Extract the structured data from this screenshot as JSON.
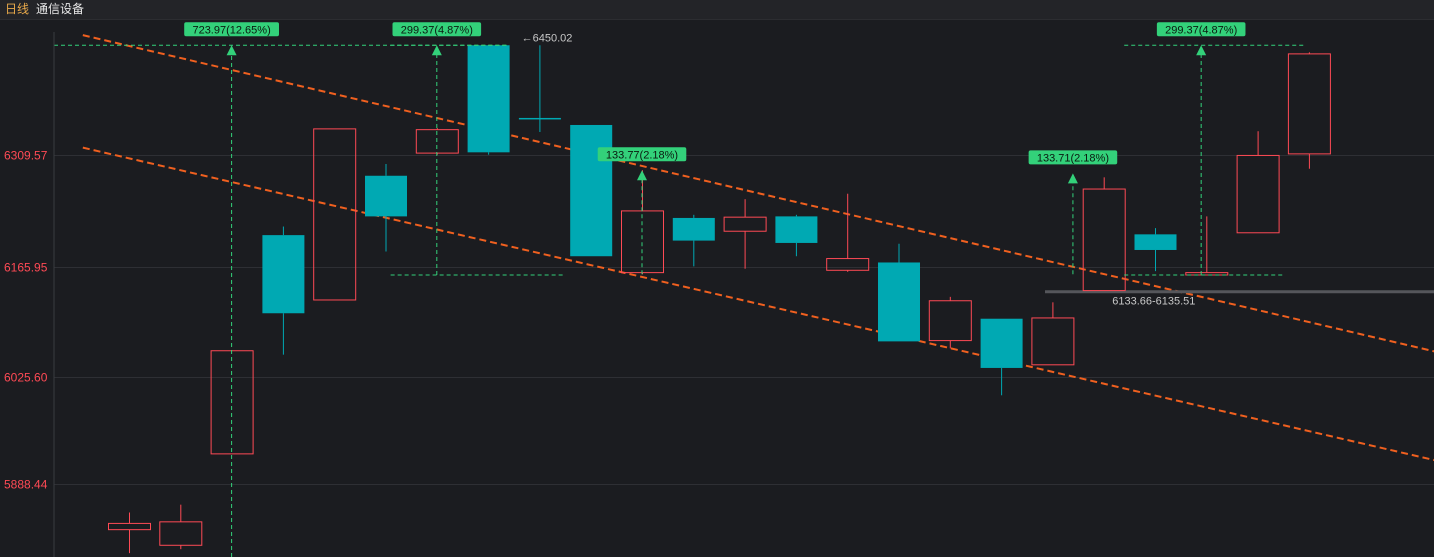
{
  "header": {
    "timeframe": "日线",
    "symbol": "通信设备"
  },
  "colors": {
    "up": "#ff4a55",
    "down": "#00a9b3",
    "trend": "#f0601f",
    "measure": "#33d17a",
    "grid": "#2e2f34",
    "axis": "#ff4a55"
  },
  "chart_data": {
    "type": "candlestick",
    "y_ticks": [
      6309.57,
      6165.95,
      6025.6,
      5888.44
    ],
    "ylim": [
      5800,
      6490
    ],
    "candles": [
      {
        "o": 5830,
        "c": 5838,
        "h": 5852,
        "l": 5800,
        "dir": "up"
      },
      {
        "o": 5810,
        "c": 5840,
        "h": 5862,
        "l": 5805,
        "dir": "up"
      },
      {
        "o": 5927,
        "c": 6059,
        "h": 6059,
        "l": 5927,
        "dir": "up"
      },
      {
        "o": 6207,
        "c": 6107,
        "h": 6218,
        "l": 6054,
        "dir": "down"
      },
      {
        "o": 6124,
        "c": 6343,
        "h": 6343,
        "l": 6124,
        "dir": "up"
      },
      {
        "o": 6231,
        "c": 6283,
        "h": 6298,
        "l": 6186,
        "dir": "down"
      },
      {
        "o": 6312,
        "c": 6342,
        "h": 6344,
        "l": 6310,
        "dir": "up"
      },
      {
        "o": 6450.02,
        "c": 6313,
        "h": 6450.02,
        "l": 6310,
        "dir": "down"
      },
      {
        "o": 6356,
        "c": 6357,
        "h": 6450,
        "l": 6339,
        "dir": "down"
      },
      {
        "o": 6348,
        "c": 6180,
        "h": 6348,
        "l": 6180,
        "dir": "down"
      },
      {
        "o": 6159,
        "c": 6238,
        "h": 6290,
        "l": 6157,
        "dir": "up"
      },
      {
        "o": 6229,
        "c": 6200,
        "h": 6233,
        "l": 6167,
        "dir": "down"
      },
      {
        "o": 6212,
        "c": 6230,
        "h": 6253,
        "l": 6164,
        "dir": "up"
      },
      {
        "o": 6231,
        "c": 6197,
        "h": 6233,
        "l": 6180,
        "dir": "down"
      },
      {
        "o": 6162,
        "c": 6177,
        "h": 6260,
        "l": 6160,
        "dir": "up"
      },
      {
        "o": 6172,
        "c": 6071,
        "h": 6196,
        "l": 6071,
        "dir": "down"
      },
      {
        "o": 6072,
        "c": 6123,
        "h": 6128,
        "l": 6062,
        "dir": "up"
      },
      {
        "o": 6100,
        "c": 6037,
        "h": 6100,
        "l": 6002,
        "dir": "down"
      },
      {
        "o": 6041,
        "c": 6101,
        "h": 6121,
        "l": 6041,
        "dir": "up"
      },
      {
        "o": 6136,
        "c": 6266,
        "h": 6281,
        "l": 6136,
        "dir": "up"
      },
      {
        "o": 6208,
        "c": 6188,
        "h": 6216,
        "l": 6161,
        "dir": "down"
      },
      {
        "o": 6156,
        "c": 6159,
        "h": 6231,
        "l": 6156,
        "dir": "up"
      },
      {
        "o": 6210,
        "c": 6309,
        "h": 6340,
        "l": 6210,
        "dir": "up"
      },
      {
        "o": 6311,
        "c": 6439,
        "h": 6441,
        "l": 6292,
        "dir": "up"
      }
    ],
    "trend_lines": [
      {
        "from": {
          "bar": -0.9,
          "value": 6463
        },
        "to": {
          "bar": 26.5,
          "value": 6042
        }
      },
      {
        "from": {
          "bar": -0.9,
          "value": 6319
        },
        "to": {
          "bar": 26.5,
          "value": 5903
        }
      }
    ],
    "measures": [
      {
        "label": "723.97(12.65%)",
        "bar": 2,
        "from": 5700,
        "to": 6450.02,
        "top_line_to_bar": 7
      },
      {
        "label": "299.37(4.87%)",
        "bar": 6,
        "from": 6156,
        "to": 6450.02,
        "top_line_to_bar": 7,
        "base_line_to_bar": 8.5
      },
      {
        "label": "133.77(2.18%)",
        "bar": 10,
        "from": 6157,
        "to": 6290
      },
      {
        "label": "133.71(2.18%)",
        "bar": 18.4,
        "from": 6157,
        "to": 6286
      },
      {
        "label": "299.37(4.87%)",
        "bar": 20.9,
        "from": 6156,
        "to": 6450.02,
        "line_from_bar": 19.4,
        "line_to_bar": 22.5
      }
    ],
    "annotations": [
      {
        "text": "←6450.02",
        "bar": 7.4,
        "value": 6450.02
      },
      {
        "text": "6133.66-6135.51",
        "bar": 19.4,
        "value": 6134.6
      }
    ]
  }
}
